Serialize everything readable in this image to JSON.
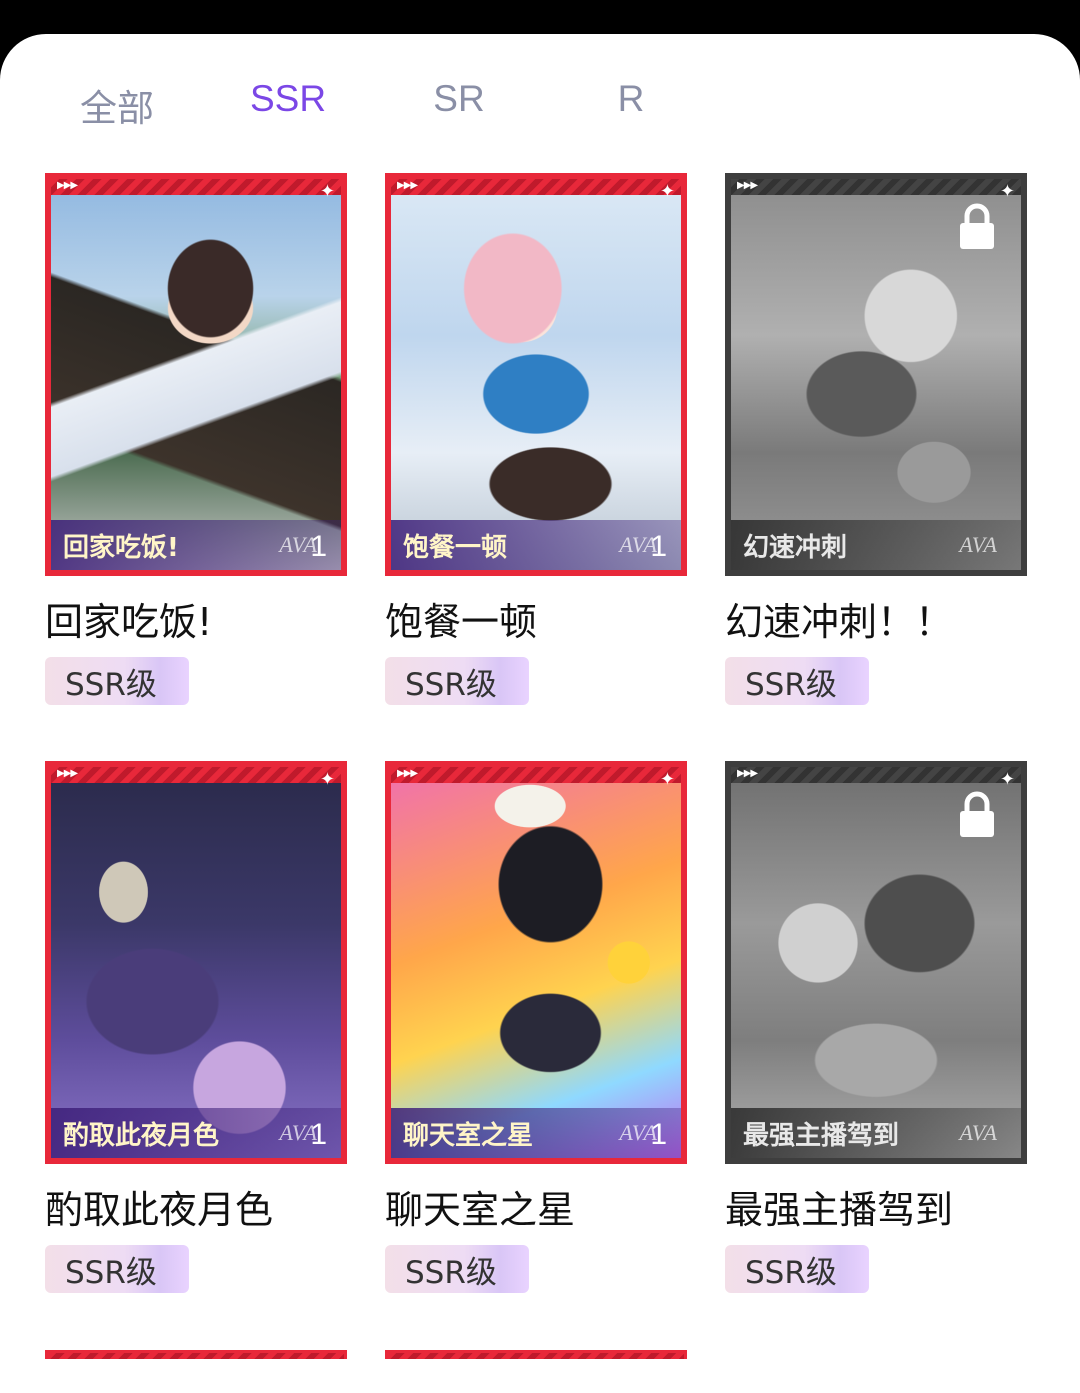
{
  "tabs": [
    {
      "label": "全部",
      "active": false
    },
    {
      "label": "SSR",
      "active": true
    },
    {
      "label": "SR",
      "active": false
    },
    {
      "label": "R",
      "active": false
    }
  ],
  "colors": {
    "accent": "#7b47e6",
    "frame_red": "#e8283a",
    "frame_locked": "#3e3e3e"
  },
  "cards": [
    {
      "caption": "回家吃饭!",
      "name": "回家吃饭!",
      "badge": "SSR级",
      "count": "1",
      "locked": false,
      "icon": "character-portrait"
    },
    {
      "caption": "饱餐一顿",
      "name": "饱餐一顿",
      "badge": "SSR级",
      "count": "1",
      "locked": false,
      "icon": "character-portrait"
    },
    {
      "caption": "幻速冲刺",
      "name": "幻速冲刺！！",
      "badge": "SSR级",
      "count": "",
      "locked": true,
      "icon": "lock-icon"
    },
    {
      "caption": "酌取此夜月色",
      "name": "酌取此夜月色",
      "badge": "SSR级",
      "count": "1",
      "locked": false,
      "icon": "character-portrait"
    },
    {
      "caption": "聊天室之星",
      "name": "聊天室之星",
      "badge": "SSR级",
      "count": "1",
      "locked": false,
      "icon": "character-portrait"
    },
    {
      "caption": "最强主播驾到",
      "name": "最强主播驾到",
      "badge": "SSR级",
      "count": "",
      "locked": true,
      "icon": "lock-icon"
    }
  ]
}
